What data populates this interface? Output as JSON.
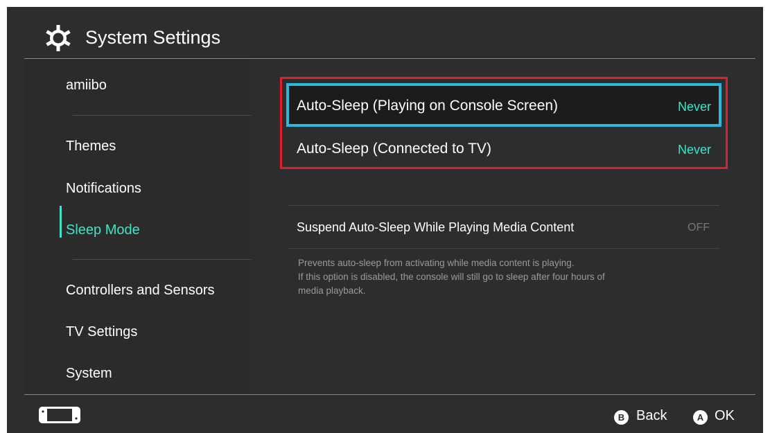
{
  "header": {
    "title": "System Settings",
    "icon": "gear-icon"
  },
  "sidebar": {
    "items": [
      {
        "label": "amiibo"
      },
      {
        "label": "Themes"
      },
      {
        "label": "Notifications"
      },
      {
        "label": "Sleep Mode",
        "active": true
      },
      {
        "label": "Controllers and Sensors"
      },
      {
        "label": "TV Settings"
      },
      {
        "label": "System"
      }
    ]
  },
  "main": {
    "settings": [
      {
        "label": "Auto-Sleep (Playing on Console Screen)",
        "value": "Never",
        "selected": true
      },
      {
        "label": "Auto-Sleep (Connected to TV)",
        "value": "Never"
      }
    ],
    "media_setting": {
      "label": "Suspend Auto-Sleep While Playing Media Content",
      "value": "OFF",
      "description_line1": "Prevents auto-sleep from activating while media content is playing.",
      "description_line2": "If this option is disabled, the console will still go to sleep after four hours of",
      "description_line3": "media playback."
    }
  },
  "footer": {
    "back_button": "B",
    "back_label": "Back",
    "ok_button": "A",
    "ok_label": "OK"
  },
  "colors": {
    "background": "#2d2d2d",
    "accent": "#40e3c6",
    "selection_border": "#2fb6dc",
    "highlight_box": "#e11e2b"
  }
}
